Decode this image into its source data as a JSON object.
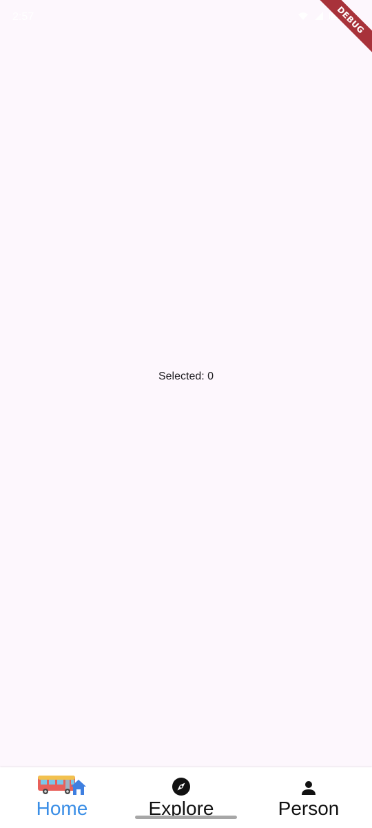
{
  "status_bar": {
    "time": "2:57"
  },
  "debug_banner": "DEBUG",
  "main": {
    "selected_text": "Selected: 0"
  },
  "bottom_nav": {
    "items": [
      {
        "label": "Home",
        "icon": "bus-home-icon",
        "active": true
      },
      {
        "label": "Explore",
        "icon": "compass-icon",
        "active": false
      },
      {
        "label": "Person",
        "icon": "person-icon",
        "active": false
      }
    ],
    "active_color": "#3a8ee6",
    "inactive_color": "#111111"
  },
  "colors": {
    "background": "#fdf7fd",
    "nav_background": "#ffffff",
    "debug_ribbon": "#a8323a"
  }
}
